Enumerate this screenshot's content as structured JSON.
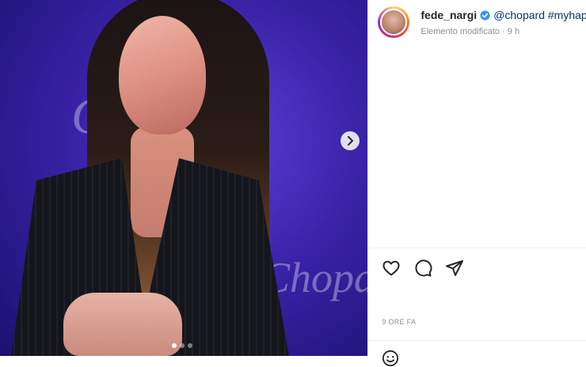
{
  "post": {
    "media": {
      "background_logo_text": "Chopard",
      "next_icon": "chevron-right-icon",
      "carousel": {
        "dot_count": 3,
        "active_index": 0
      }
    },
    "header": {
      "username": "fede_nargi",
      "verified_icon": "verified-badge-icon",
      "caption": "@chopard #myhapp",
      "subline": "Elemento modificato · 9 h"
    },
    "actions": {
      "like_icon": "heart-icon",
      "comment_icon": "comment-icon",
      "share_icon": "paper-plane-icon"
    },
    "timestamp": "9 ORE FA",
    "emoji_icon": "emoji-icon",
    "colors": {
      "link": "#00376b",
      "muted": "#8e8e8e",
      "verified": "#3897f0"
    }
  }
}
